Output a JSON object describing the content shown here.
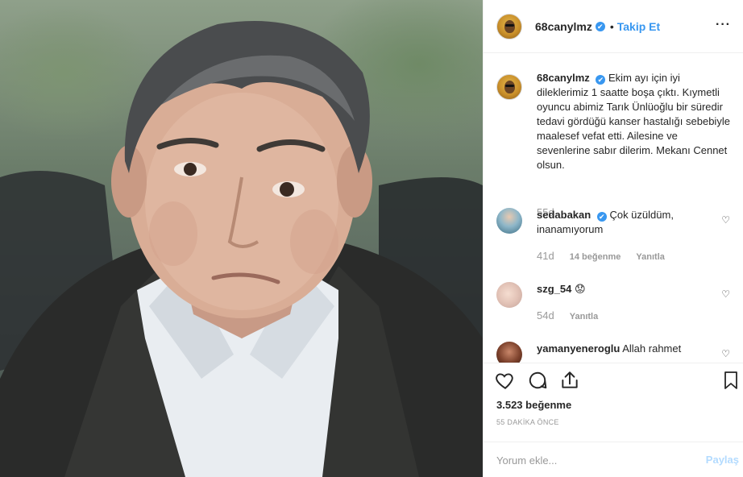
{
  "post": {
    "username": "68canylmz",
    "verified_badge": "✔",
    "follow_separator": "•",
    "follow_label": "Takip Et",
    "more_label": "···"
  },
  "caption": {
    "username": "68canylmz",
    "text": "Ekim ayı için iyi dileklerimiz 1 saatte boşa çıktı. Kıymetli oyuncu abimiz Tarık Ünlüoğlu bir süredir tedavi gördüğü kanser hastalığı sebebiyle maalesef vefat etti. Ailesine ve sevenlerine sabır dilerim. Mekanı Cennet olsun.",
    "time": "55d"
  },
  "comments": [
    {
      "username": "sedabakan",
      "verified": true,
      "text": "Çok üzüldüm, inanamıyorum",
      "time": "41d",
      "likes": "14 beğenme",
      "reply": "Yanıtla"
    },
    {
      "username": "szg_54",
      "verified": false,
      "text": "😟",
      "time": "54d",
      "likes": "",
      "reply": "Yanıtla"
    },
    {
      "username": "yamanyeneroglu",
      "verified": false,
      "text": "Allah rahmet",
      "time": "",
      "likes": "",
      "reply": ""
    }
  ],
  "actions": {
    "like_icon": "heart-icon",
    "comment_icon": "comment-icon",
    "share_icon": "share-icon",
    "save_icon": "bookmark-icon"
  },
  "stats": {
    "likes": "3.523 beğenme",
    "posted": "55 DAKİKA ÖNCE"
  },
  "add_comment": {
    "placeholder": "Yorum ekle...",
    "post_label": "Paylaş"
  },
  "colors": {
    "accent": "#3897f0",
    "post_disabled": "#b3dbff",
    "muted": "#999999"
  }
}
